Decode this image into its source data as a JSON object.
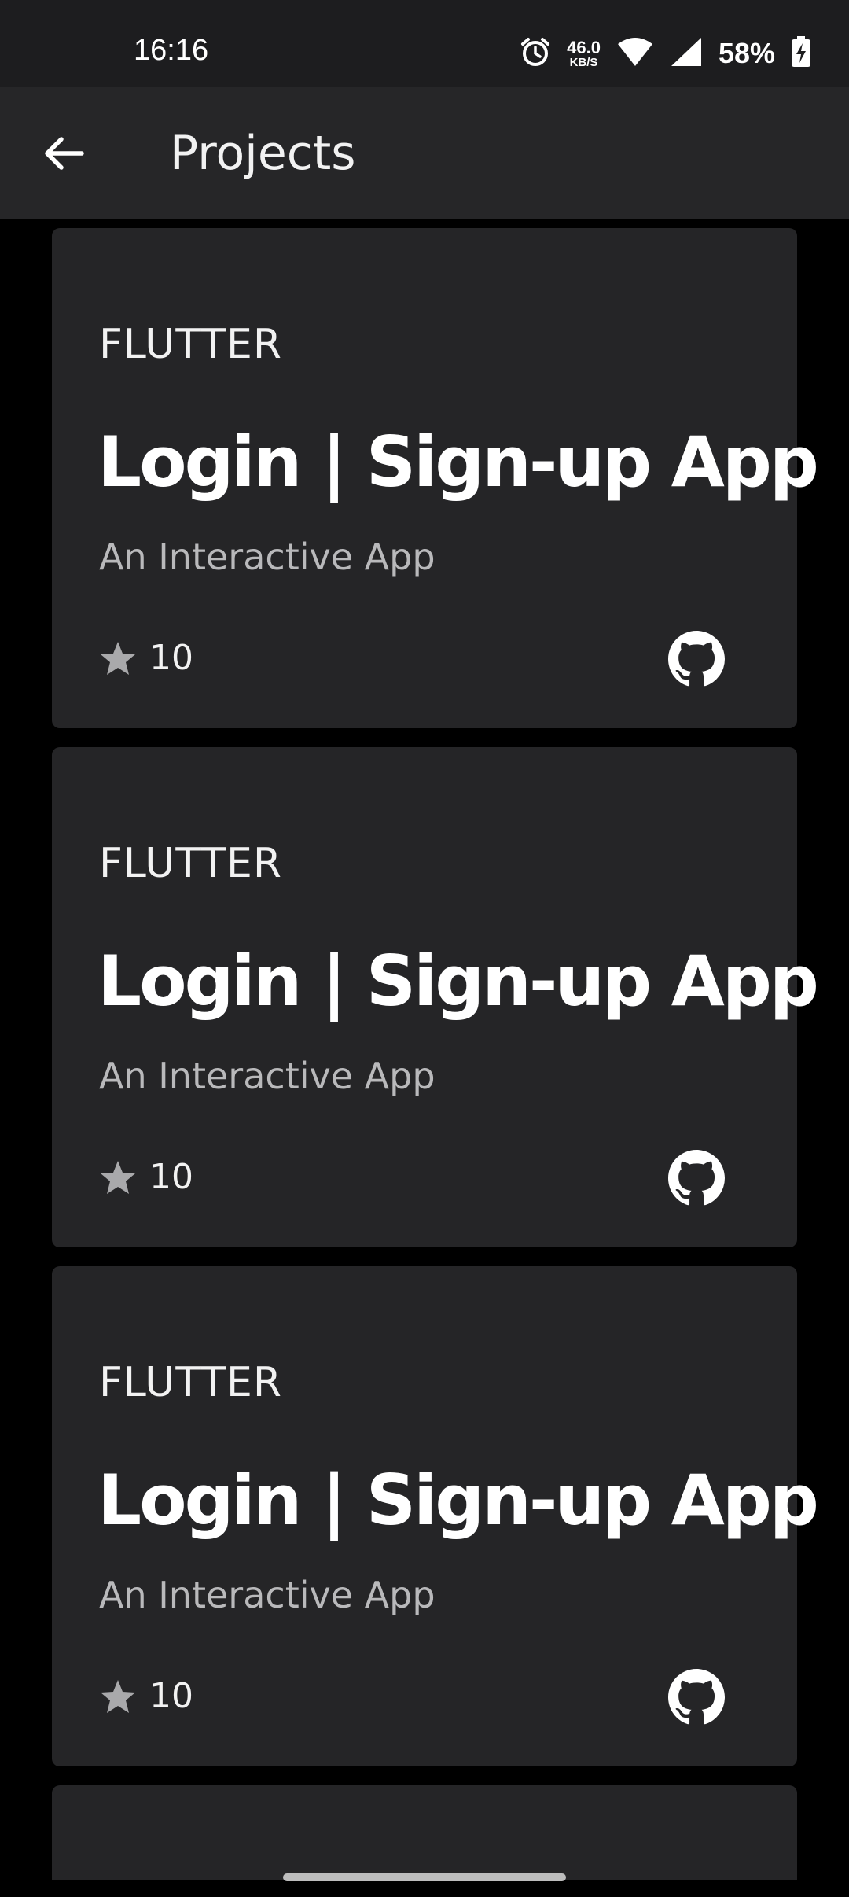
{
  "status_bar": {
    "time": "16:16",
    "net_speed_value": "46.0",
    "net_speed_unit": "KB/S",
    "battery": "58%",
    "icons": [
      "alarm-icon",
      "wifi-icon",
      "cell-signal-icon",
      "battery-charging-icon"
    ]
  },
  "app_bar": {
    "title": "Projects",
    "back_icon": "arrow-left-icon"
  },
  "projects": [
    {
      "tag": "FLUTTER",
      "title": "Login | Sign-up App",
      "subtitle": "An Interactive App",
      "stars": "10",
      "icon": "github-icon"
    },
    {
      "tag": "FLUTTER",
      "title": "Login | Sign-up App",
      "subtitle": "An Interactive App",
      "stars": "10",
      "icon": "github-icon"
    },
    {
      "tag": "FLUTTER",
      "title": "Login | Sign-up App",
      "subtitle": "An Interactive App",
      "stars": "10",
      "icon": "github-icon"
    }
  ],
  "colors": {
    "background": "#000000",
    "app_bar": "#262628",
    "card": "#252527",
    "subtitle": "#b9b9bb",
    "star": "#a9a9ab"
  }
}
